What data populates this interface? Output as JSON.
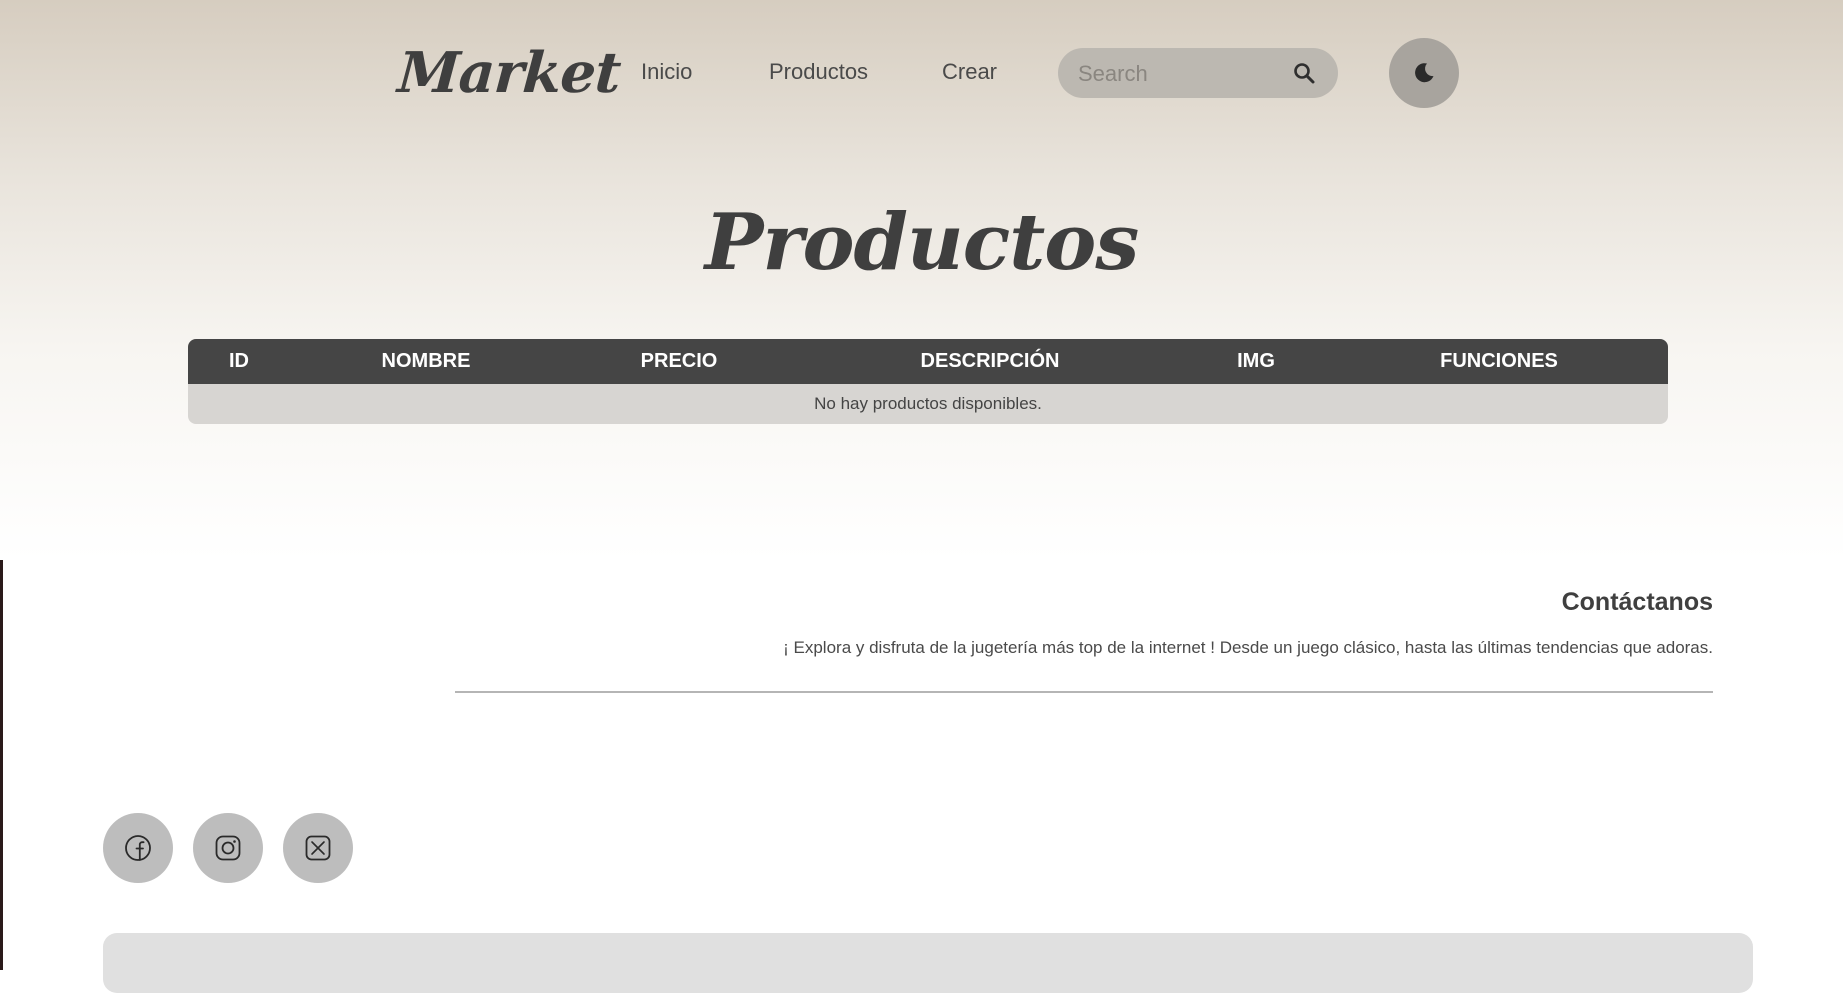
{
  "header": {
    "logo": "Market",
    "nav": [
      {
        "label": "Inicio"
      },
      {
        "label": "Productos"
      },
      {
        "label": "Crear"
      }
    ],
    "search": {
      "placeholder": "Search",
      "value": ""
    },
    "search_icon": "search-icon",
    "theme_toggle_icon": "moon-icon"
  },
  "main": {
    "title": "Productos",
    "table": {
      "columns": [
        "ID",
        "NOMBRE",
        "PRECIO",
        "DESCRIPCIÓN",
        "IMG",
        "FUNCIONES"
      ],
      "empty_message": "No hay productos disponibles."
    }
  },
  "contact": {
    "title": "Contáctanos",
    "text": "¡ Explora y disfruta de la jugetería más top de la internet ! Desde un juego clásico, hasta las últimas tendencias que adoras."
  },
  "social": [
    {
      "icon": "facebook-icon"
    },
    {
      "icon": "instagram-icon"
    },
    {
      "icon": "x-twitter-icon"
    }
  ],
  "colors": {
    "header_bg": "#d6cdc0",
    "table_header": "#454545",
    "table_body": "#d7d5d2",
    "text_dark": "#3f3f3f",
    "search_bg": "#bcb8b1",
    "button_bg": "#a8a49e"
  }
}
